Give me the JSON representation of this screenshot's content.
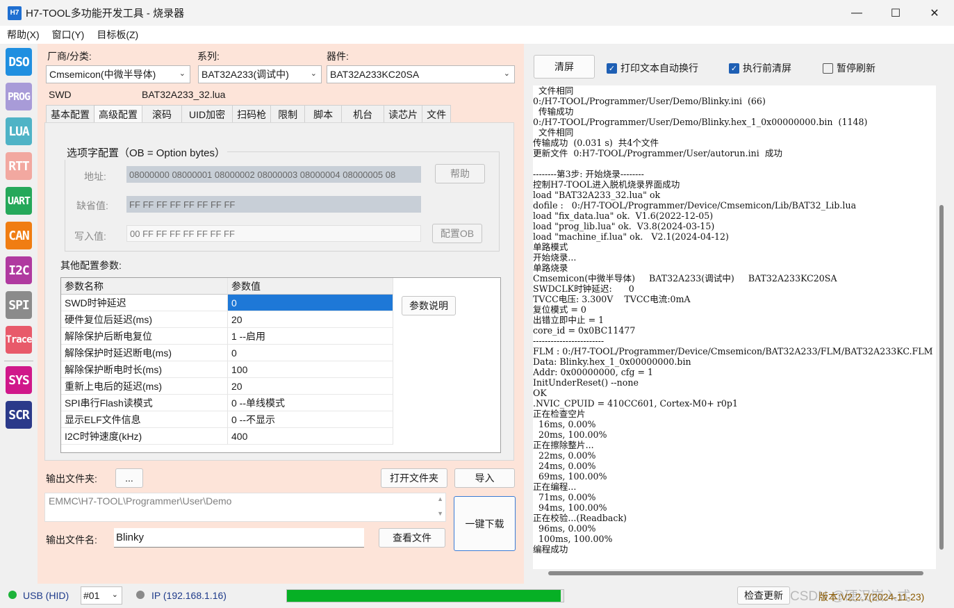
{
  "window": {
    "icon_text": "H7",
    "title": "H7-TOOL多功能开发工具 - 烧录器",
    "controls": [
      "—",
      "☐",
      "✕"
    ]
  },
  "menu": [
    "帮助(X)",
    "窗口(Y)",
    "目标板(Z)"
  ],
  "toolbar": {
    "items": [
      {
        "label": "DSO",
        "color": "#1f8fe0"
      },
      {
        "label": "PROG",
        "color": "#a89bd8"
      },
      {
        "label": "LUA",
        "color": "#4fb3c6"
      },
      {
        "label": "RTT",
        "color": "#f2a8a0"
      },
      {
        "label": "UART",
        "color": "#25a85a"
      },
      {
        "label": "CAN",
        "color": "#f07d12"
      },
      {
        "label": "I2C",
        "color": "#b03aa0"
      },
      {
        "label": "SPI",
        "color": "#8b8b8b"
      },
      {
        "label": "Trace",
        "color": "#e85a6a"
      },
      {
        "label": "SYS",
        "color": "#d0188a"
      },
      {
        "label": "SCR",
        "color": "#2b3a8a"
      }
    ]
  },
  "selector": {
    "vendor_label": "厂商/分类:",
    "vendor_value": "Cmsemicon(中微半导体)",
    "series_label": "系列:",
    "series_value": "BAT32A233(调试中)",
    "device_label": "器件:",
    "device_value": "BAT32A233KC20SA",
    "interface": "SWD",
    "lua_file": "BAT32A233_32.lua"
  },
  "tabs": [
    "基本配置",
    "高级配置",
    "滚码",
    "UID加密",
    "扫码枪",
    "限制",
    "脚本",
    "机台",
    "读芯片",
    "文件"
  ],
  "active_tab": 1,
  "option_bytes": {
    "title": "选项字配置（OB = Option bytes）",
    "addr_label": "地址:",
    "addr_value": "08000000 08000001 08000002 08000003 08000004 08000005 08",
    "help_button": "帮助",
    "default_label": "缺省值:",
    "default_value": "FF FF FF FF FF FF FF FF",
    "write_label": "写入值:",
    "write_value": "00 FF FF FF FF FF FF FF",
    "config_button": "配置OB"
  },
  "other_params": {
    "title": "其他配置参数:",
    "headers": [
      "参数名称",
      "参数值"
    ],
    "rows": [
      [
        "SWD时钟延迟",
        "0"
      ],
      [
        "硬件复位后延迟(ms)",
        "20"
      ],
      [
        "解除保护后断电复位",
        "1 --启用"
      ],
      [
        "解除保护时延迟断电(ms)",
        "0"
      ],
      [
        "解除保护断电时长(ms)",
        "100"
      ],
      [
        "重新上电后的延迟(ms)",
        "20"
      ],
      [
        "SPI串行Flash读模式",
        "0 --单线模式"
      ],
      [
        "显示ELF文件信息",
        "0 --不显示"
      ],
      [
        "I2C时钟速度(kHz)",
        "400"
      ]
    ],
    "help_button": "参数说明"
  },
  "output": {
    "folder_label": "输出文件夹:",
    "browse_button": "...",
    "open_folder_button": "打开文件夹",
    "import_button": "导入",
    "folder_path": "EMMC\\H7-TOOL\\Programmer\\User\\Demo",
    "file_label": "输出文件名:",
    "file_value": "Blinky",
    "view_file_button": "查看文件",
    "one_key_download": "一键下载"
  },
  "log_panel": {
    "clear_button": "清屏",
    "options": [
      {
        "label": "打印文本自动换行",
        "checked": true
      },
      {
        "label": "执行前清屏",
        "checked": true
      },
      {
        "label": "暂停刷新",
        "checked": false
      }
    ],
    "lines": [
      "  文件相同",
      "0:/H7-TOOL/Programmer/User/Demo/Blinky.ini  (66)",
      "  传输成功",
      "0:/H7-TOOL/Programmer/User/Demo/Blinky.hex_1_0x00000000.bin  (1148)",
      "  文件相同",
      "传输成功  (0.031 s)  共4个文件",
      "更新文件  0:H7-TOOL/Programmer/User/autorun.ini  成功",
      "",
      "--------第3步: 开始烧录--------",
      "控制H7-TOOL进入脱机烧录界面成功",
      "load \"BAT32A233_32.lua\" ok",
      "dofile :   0:/H7-TOOL/Programmer/Device/Cmsemicon/Lib/BAT32_Lib.lua",
      "load \"fix_data.lua\" ok.  V1.6(2022-12-05)",
      "load \"prog_lib.lua\" ok.  V3.8(2024-03-15)",
      "load \"machine_if.lua\" ok.   V2.1(2024-04-12)",
      "单路模式",
      "开始烧录...",
      "单路烧录",
      "Cmsemicon(中微半导体)     BAT32A233(调试中)     BAT32A233KC20SA",
      "SWDCLK时钟延迟:      0",
      "TVCC电压: 3.300V    TVCC电流:0mA",
      "复位模式 = 0",
      "出错立即中止 = 1",
      "core_id = 0x0BC11477",
      "------------------------",
      "FLM : 0:/H7-TOOL/Programmer/Device/Cmsemicon/BAT32A233/FLM/BAT32A233KC.FLM",
      "Data: Blinky.hex_1_0x00000000.bin",
      "Addr: 0x00000000, cfg = 1",
      "InitUnderReset() --none",
      "OK",
      ".NVIC_CPUID = 410CC601, Cortex-M0+ r0p1",
      "正在检查空片",
      "  16ms, 0.00%",
      "  20ms, 100.00%",
      "正在擦除整片...",
      "  22ms, 0.00%",
      "  24ms, 0.00%",
      "  69ms, 100.00%",
      "正在编程...",
      "  71ms, 0.00%",
      "  94ms, 100.00%",
      "正在校验...(Readback)",
      "  96ms, 0.00%",
      "  100ms, 100.00%",
      "编程成功"
    ]
  },
  "status": {
    "usb": "USB (HID)",
    "channel": "#01",
    "ip": "IP (192.168.1.16)",
    "progress": 0.99,
    "check_update": "检查更新",
    "watermark": "CSDN @硬汉嵌入式",
    "version": "版本:V2.2.7(2024-11-23)",
    "usb_color": "#1db33a",
    "ip_color": "#8a8a8a"
  }
}
